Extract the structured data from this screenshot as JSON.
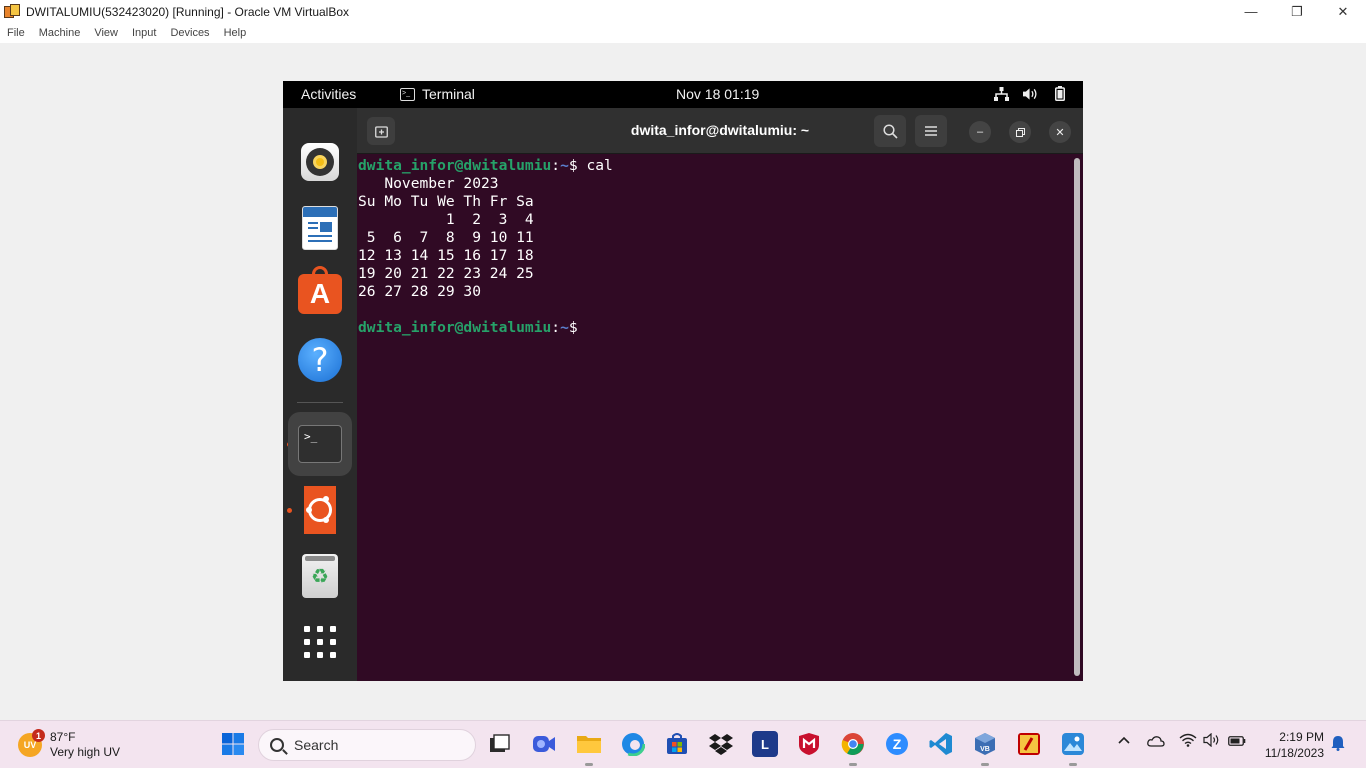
{
  "window": {
    "title": "DWITALUMIU(532423020) [Running] - Oracle VM VirtualBox",
    "controls": {
      "minimize": "—",
      "restore": "❐",
      "close": "✕"
    }
  },
  "menubar": {
    "items": [
      "File",
      "Machine",
      "View",
      "Input",
      "Devices",
      "Help"
    ]
  },
  "guest": {
    "topbar": {
      "activities": "Activities",
      "app_name": "Terminal",
      "clock": "Nov 18  01:19"
    },
    "dock": {
      "items": [
        "Rhythmbox",
        "LibreOffice Writer",
        "Ubuntu Software",
        "Help",
        "Terminal",
        "Ubuntu",
        "Trash",
        "Show Applications"
      ]
    },
    "terminal": {
      "title": "dwita_infor@dwitalumiu: ~",
      "prompt_user": "dwita_infor@dwitalumiu",
      "prompt_sep": ":",
      "prompt_path": "~",
      "prompt_end": "$ ",
      "command": "cal",
      "output_lines": [
        "   November 2023",
        "Su Mo Tu We Th Fr Sa",
        "          1  2  3  4",
        " 5  6  7  8  9 10 11",
        "12 13 14 15 16 17 18",
        "19 20 21 22 23 24 25",
        "26 27 28 29 30",
        ""
      ]
    }
  },
  "taskbar": {
    "weather": {
      "temp": "87°F",
      "condition": "Very high UV",
      "badge": "1",
      "icon_text": "UV"
    },
    "search_placeholder": "Search",
    "pinned": [
      "start-icon",
      "file-explorer-icon",
      "task-view-icon",
      "meet-icon",
      "folder-icon",
      "edge-icon",
      "store-icon",
      "dropbox-icon",
      "l-app-icon",
      "mcafee-icon",
      "chrome-icon",
      "zoom-icon",
      "vscode-icon",
      "virtualbox-icon",
      "filezilla-icon",
      "photos-icon"
    ],
    "clock_time": "2:19 PM",
    "clock_date": "11/18/2023"
  }
}
